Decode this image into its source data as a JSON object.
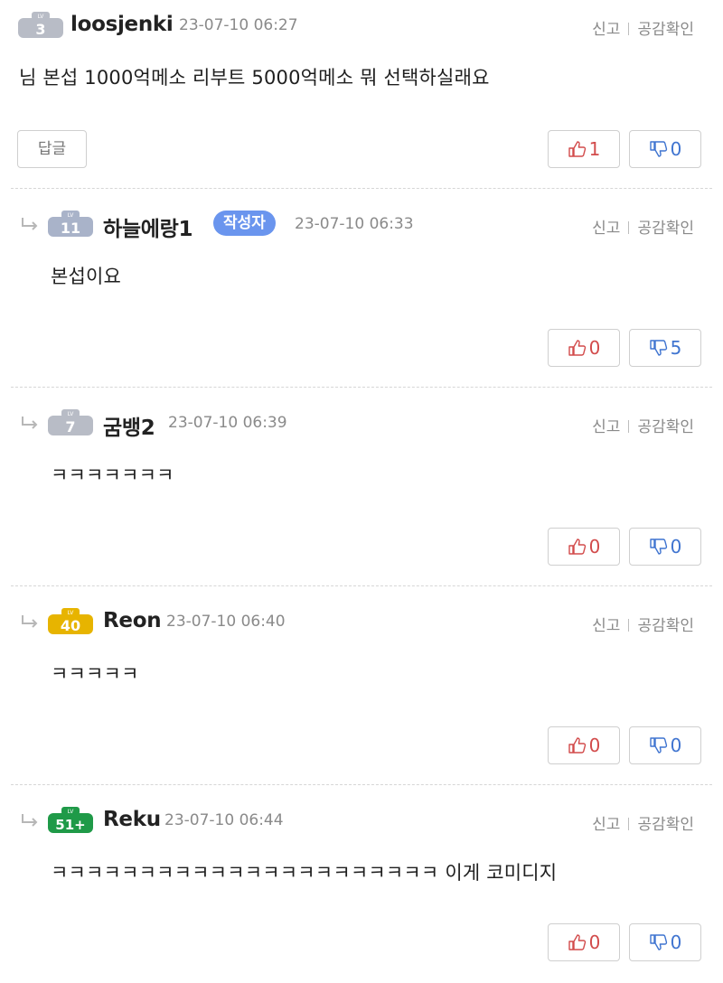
{
  "actions": {
    "report": "신고",
    "agree_check": "공감확인"
  },
  "reply_button": "답글",
  "comments": [
    {
      "level": "3",
      "nick": "loosjenki",
      "date": "23-07-10 06:27",
      "text": "님 본섭 1000억메소 리부트 5000억메소 뭐 선택하실래요",
      "likes": "1",
      "dislikes": "0",
      "badge_color": "#b8bcc6",
      "is_reply": false
    },
    {
      "level": "11",
      "nick": "하늘에랑1",
      "author_tag": "작성자",
      "date": "23-07-10 06:33",
      "text": "본섭이요",
      "likes": "0",
      "dislikes": "5",
      "badge_color": "#a9b3c9",
      "is_reply": true
    },
    {
      "level": "7",
      "nick": "굼뱅2",
      "date": "23-07-10 06:39",
      "text": "ㅋㅋㅋㅋㅋㅋㅋ",
      "likes": "0",
      "dislikes": "0",
      "badge_color": "#b8bcc6",
      "is_reply": true
    },
    {
      "level": "40",
      "nick": "Reon",
      "date": "23-07-10 06:40",
      "text": "ㅋㅋㅋㅋㅋ",
      "likes": "0",
      "dislikes": "0",
      "badge_color": "#e7b400",
      "is_reply": true
    },
    {
      "level": "51+",
      "nick": "Reku",
      "date": "23-07-10 06:44",
      "text": "ㅋㅋㅋㅋㅋㅋㅋㅋㅋㅋㅋㅋㅋㅋㅋㅋㅋㅋㅋㅋㅋㅋ 이게 코미디지",
      "likes": "0",
      "dislikes": "0",
      "badge_color": "#1f9a48",
      "is_reply": true
    }
  ]
}
